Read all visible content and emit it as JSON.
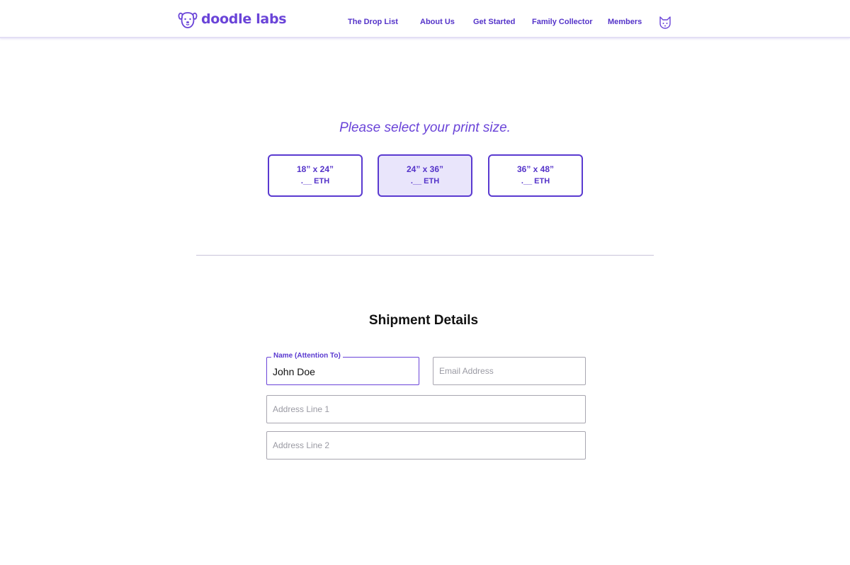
{
  "header": {
    "brand": "doodle labs",
    "nav": [
      {
        "label": "The Drop List"
      },
      {
        "label": "About Us"
      },
      {
        "label": "Get Started"
      },
      {
        "label": "Family Collector"
      },
      {
        "label": "Members"
      }
    ],
    "account_icon": "cat-avatar-icon",
    "logo_icon": "doodle-dog-icon"
  },
  "print_size": {
    "prompt": "Please select your print size.",
    "options": [
      {
        "label": "18” x 24”",
        "price": ".__ ETH",
        "selected": false
      },
      {
        "label": "24” x 36”",
        "price": ".__ ETH",
        "selected": true
      },
      {
        "label": "36” x 48”",
        "price": ".__ ETH",
        "selected": false
      }
    ]
  },
  "shipment": {
    "title": "Shipment Details",
    "name_field": {
      "label": "Name (Attention To)",
      "value": "John Doe"
    },
    "email_field": {
      "placeholder": "Email Address",
      "value": ""
    },
    "address1_field": {
      "placeholder": "Address Line 1",
      "value": ""
    },
    "address2_field": {
      "placeholder": "Address Line 2",
      "value": ""
    }
  },
  "colors": {
    "accent": "#6a44d8",
    "accent_dark": "#5433c9",
    "selected_bg": "#e9e5fb",
    "border": "#a8a6b0"
  }
}
